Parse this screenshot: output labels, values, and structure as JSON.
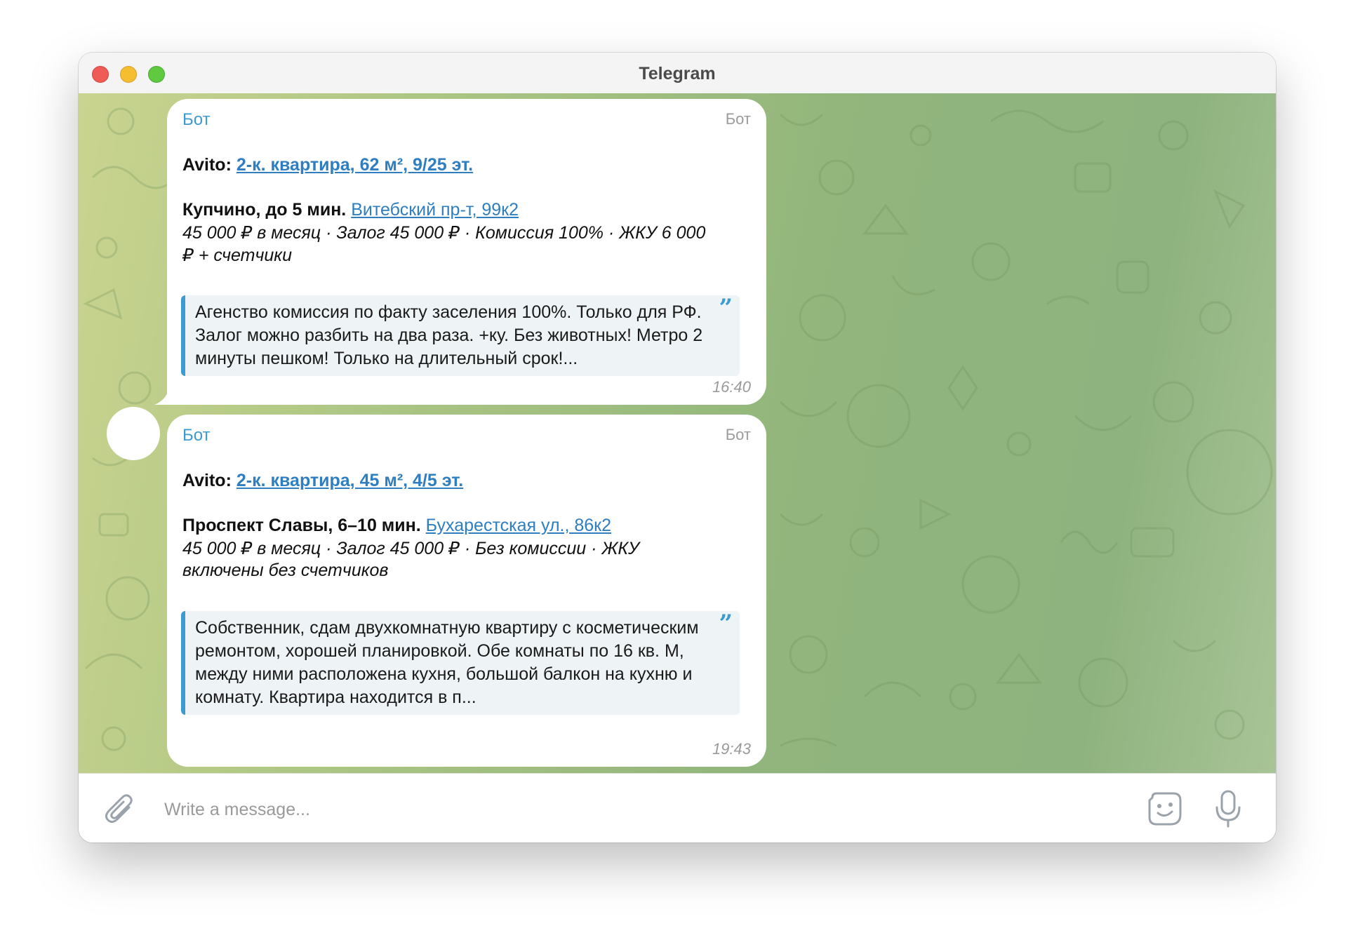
{
  "window": {
    "title": "Telegram"
  },
  "messages": [
    {
      "sender": "Бот",
      "sender_tag": "Бот",
      "source_label": "Avito:",
      "listing_link": "2-к. квартира, 62 м², 9/25 эт.",
      "location_label": "Купчино, до 5 мин.",
      "address_link": "Витебский пр-т, 99к2",
      "price_line_1": "45 000 ₽ в месяц · Залог 45 000 ₽ · Комиссия 100% · ЖКУ 6 000",
      "price_line_2": "₽ + счетчики",
      "quote": "Агенство комиссия по факту заселения 100%. Только для РФ. Залог можно разбить на два раза. +ку. Без животных! Метро 2 минуты пешком! Только на длительный срок!...",
      "time": "16:40"
    },
    {
      "sender": "Бот",
      "sender_tag": "Бот",
      "source_label": "Avito:",
      "listing_link": "2-к. квартира, 45 м², 4/5 эт.",
      "location_label": "Проспект Славы, 6–10 мин.",
      "address_link": "Бухарестская ул., 86к2",
      "price_line_1": "45 000 ₽ в месяц · Залог 45 000 ₽ · Без комиссии · ЖКУ",
      "price_line_2": "включены без счетчиков",
      "quote": "Собственник, сдам двухкомнатную квартиру с косметическим ремонтом, хорошей планировкой. Обе комнаты по 16 кв. М, между ними расположена кухня, большой балкон на кухню и комнату. Квартира находится в п...",
      "time": "19:43"
    }
  ],
  "composer": {
    "placeholder": "Write a message...",
    "attach_icon": "paperclip-icon",
    "sticker_icon": "sticker-icon",
    "mic_icon": "microphone-icon"
  },
  "colors": {
    "accent": "#3c9bd0",
    "link": "#2e7ec1",
    "quote_bg": "#eef3f6",
    "chat_bg": "#a9c482"
  }
}
